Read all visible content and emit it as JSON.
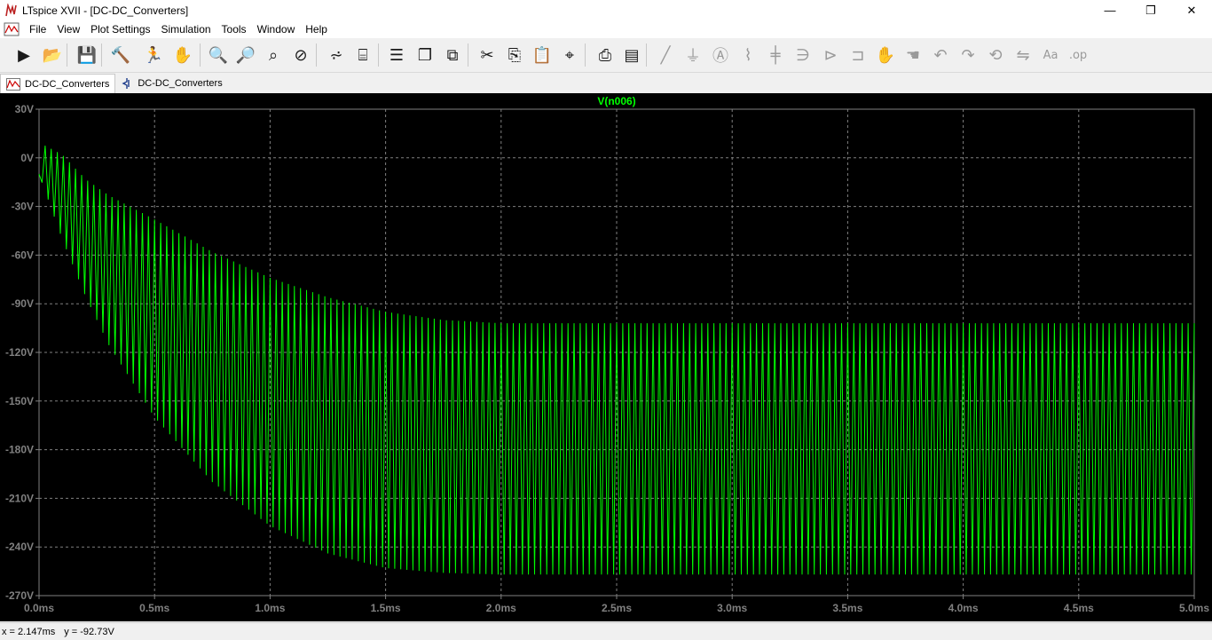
{
  "window": {
    "title": "LTspice XVII - [DC-DC_Converters]",
    "minimize": "—",
    "maximize": "❐",
    "close": "✕"
  },
  "menu": [
    {
      "label": "File",
      "name": "menu-file"
    },
    {
      "label": "View",
      "name": "menu-view"
    },
    {
      "label": "Plot Settings",
      "name": "menu-plot-settings"
    },
    {
      "label": "Simulation",
      "name": "menu-simulation"
    },
    {
      "label": "Tools",
      "name": "menu-tools"
    },
    {
      "label": "Window",
      "name": "menu-window"
    },
    {
      "label": "Help",
      "name": "menu-help"
    }
  ],
  "mdi": {
    "minimize": "–",
    "restore": "▫",
    "close": "×"
  },
  "toolbar_icons": [
    "run-icon",
    "open-icon",
    "save-icon",
    "control-panel-icon",
    "halt-icon",
    "pan-icon",
    "zoom-in-icon",
    "zoom-out-icon",
    "zoom-fit-icon",
    "zoom-cancel-icon",
    "autorange-icon",
    "plot-settings-icon",
    "tile-horizontal-icon",
    "cascade-icon",
    "tile-vertical-icon",
    "cut-icon",
    "copy-icon",
    "paste-icon",
    "find-icon",
    "print-icon",
    "print-preview-icon",
    "wire-icon",
    "ground-icon",
    "label-icon",
    "resistor-icon",
    "capacitor-icon",
    "inductor-icon",
    "diode-icon",
    "component-icon",
    "move-icon",
    "drag-icon",
    "undo-icon",
    "redo-icon",
    "rotate-icon",
    "mirror-icon",
    "text-icon",
    "spice-directive-icon"
  ],
  "tabs": [
    {
      "label": "DC-DC_Converters",
      "icon": "waveform-icon",
      "active": true
    },
    {
      "label": "DC-DC_Converters",
      "icon": "schematic-icon",
      "active": false
    }
  ],
  "chart_data": {
    "type": "line",
    "title": "V(n006)",
    "xlabel": "",
    "ylabel": "",
    "xlim": [
      0,
      5.0
    ],
    "ylim": [
      -270,
      30
    ],
    "x_ticks": [
      "0.0ms",
      "0.5ms",
      "1.0ms",
      "1.5ms",
      "2.0ms",
      "2.5ms",
      "3.0ms",
      "3.5ms",
      "4.0ms",
      "4.5ms",
      "5.0ms"
    ],
    "y_ticks": [
      "30V",
      "0V",
      "-30V",
      "-60V",
      "-90V",
      "-120V",
      "-150V",
      "-180V",
      "-210V",
      "-240V",
      "-270V"
    ],
    "grid": true,
    "series": [
      {
        "name": "V(n006)",
        "color": "#00ff00",
        "envelope_upper": [
          [
            0.0,
            -10
          ],
          [
            0.02,
            8
          ],
          [
            0.1,
            2
          ],
          [
            0.2,
            -13
          ],
          [
            0.3,
            -23
          ],
          [
            0.5,
            -38
          ],
          [
            0.75,
            -58
          ],
          [
            1.0,
            -74
          ],
          [
            1.25,
            -86
          ],
          [
            1.5,
            -95
          ],
          [
            1.75,
            -100
          ],
          [
            2.0,
            -102
          ],
          [
            3.0,
            -102
          ],
          [
            5.0,
            -102
          ]
        ],
        "envelope_lower": [
          [
            0.0,
            -10
          ],
          [
            0.05,
            -30
          ],
          [
            0.1,
            -50
          ],
          [
            0.2,
            -85
          ],
          [
            0.3,
            -115
          ],
          [
            0.5,
            -160
          ],
          [
            0.75,
            -200
          ],
          [
            1.0,
            -227
          ],
          [
            1.25,
            -244
          ],
          [
            1.5,
            -253
          ],
          [
            1.75,
            -256
          ],
          [
            2.0,
            -257
          ],
          [
            3.0,
            -257
          ],
          [
            5.0,
            -257
          ]
        ],
        "cycles": 190
      }
    ]
  },
  "status": {
    "x_readout": "x = 2.147ms",
    "y_readout": "y = -92.73V"
  },
  "colors": {
    "plot_bg": "#000000",
    "grid": "#808080",
    "trace": "#00ff00",
    "axis_text": "#808080"
  }
}
